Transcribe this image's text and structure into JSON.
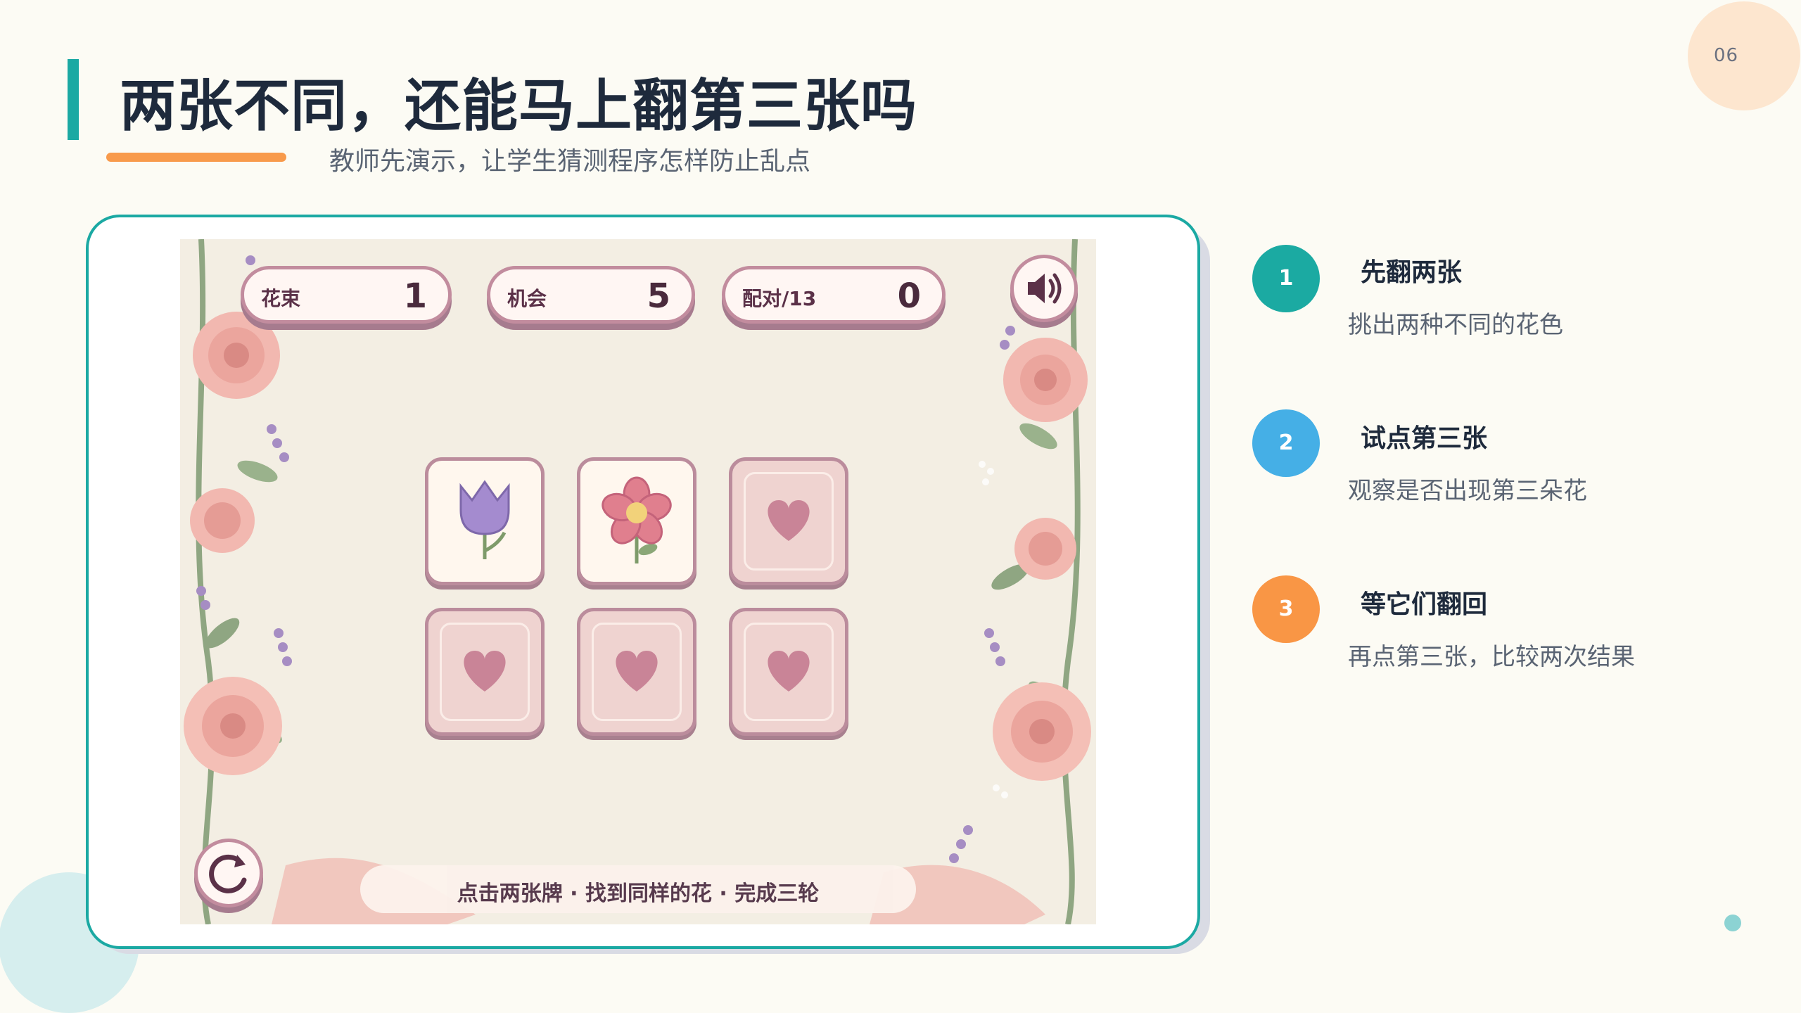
{
  "page": {
    "number": "06"
  },
  "header": {
    "title": "两张不同，还能马上翻第三张吗",
    "subtitle": "教师先演示，让学生猜测程序怎样防止乱点"
  },
  "game": {
    "hud": [
      {
        "label": "花束",
        "value": "1"
      },
      {
        "label": "机会",
        "value": "5"
      },
      {
        "label": "配对/13",
        "value": "0"
      }
    ],
    "cards": [
      {
        "state": "face-up",
        "icon": "tulip-icon"
      },
      {
        "state": "face-up",
        "icon": "flower-icon"
      },
      {
        "state": "face-down",
        "icon": "heart-icon"
      },
      {
        "state": "face-down",
        "icon": "heart-icon"
      },
      {
        "state": "face-down",
        "icon": "heart-icon"
      },
      {
        "state": "face-down",
        "icon": "heart-icon"
      }
    ],
    "hint": "点击两张牌 · 找到同样的花 · 完成三轮",
    "sound_icon": "speaker-icon",
    "replay_icon": "replay-icon"
  },
  "steps": [
    {
      "number": "1",
      "title": "先翻两张",
      "desc": "挑出两种不同的花色",
      "color": "#1BAAA2"
    },
    {
      "number": "2",
      "title": "试点第三张",
      "desc": "观察是否出现第三朵花",
      "color": "#45AFE6"
    },
    {
      "number": "3",
      "title": "等它们翻回",
      "desc": "再点第三张，比较两次结果",
      "color": "#F99645"
    }
  ],
  "colors": {
    "accent": "#1BA9A3",
    "orange": "#F89A4B",
    "card_border": "#BB8C9C"
  }
}
